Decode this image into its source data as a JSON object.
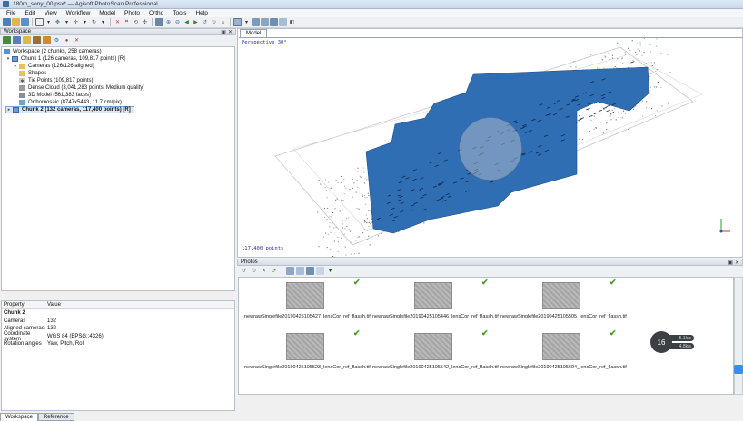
{
  "window": {
    "title": "180m_sony_00.psx* — Agisoft PhotoScan Professional"
  },
  "menubar": [
    "File",
    "Edit",
    "View",
    "Workflow",
    "Model",
    "Photo",
    "Ortho",
    "Tools",
    "Help"
  ],
  "workspace_panel": {
    "title": "Workspace",
    "tree": {
      "root": "Workspace (2 chunks, 258 cameras)",
      "chunk1": "Chunk 1 (126 cameras, 109,817 points) [R]",
      "chunk1_children": [
        {
          "label": "Cameras (126/126 aligned)",
          "icon": "folder-icon"
        },
        {
          "label": "Shapes",
          "icon": "folder-icon"
        },
        {
          "label": "Tie Points (109,817 points)",
          "icon": "points-icon"
        },
        {
          "label": "Dense Cloud (3,041,283 points, Medium quality)",
          "icon": "dense-cloud-icon"
        },
        {
          "label": "3D Model (561,383 faces)",
          "icon": "mesh-icon"
        },
        {
          "label": "Orthomosaic (8747x5443, 11.7 cm/pix)",
          "icon": "orthomosaic-icon"
        }
      ],
      "chunk2": "Chunk 2 (132 cameras, 117,400 points) [R]"
    }
  },
  "properties": {
    "header": {
      "property": "Property",
      "value": "Value"
    },
    "title": "Chunk 2",
    "rows": [
      {
        "k": "Cameras",
        "v": "132"
      },
      {
        "k": "Aligned cameras",
        "v": "132"
      },
      {
        "k": "Coordinate system",
        "v": "WGS 84 (EPSG::4326)"
      },
      {
        "k": "Rotation angles",
        "v": "Yaw, Pitch, Roll"
      }
    ]
  },
  "bottom_tabs": [
    "Workspace",
    "Reference"
  ],
  "model": {
    "tab": "Model",
    "view_label": "Perspective 30°",
    "points_label": "117,400 points"
  },
  "photos": {
    "title": "Photos",
    "items": [
      "newrawSinglefile20190425105427_lensCor_ref_flassh.tif",
      "newrawSinglefile20190425105446_lensCor_ref_flassh.tif",
      "newrawSinglefile20190425105505_lensCor_ref_flassh.tif",
      "newrawSinglefile20190425105523_lensCor_ref_flassh.tif",
      "newrawSinglefile20190425105542_lensCor_ref_flassh.tif",
      "newrawSinglefile20190425105604_lensCor_ref_flassh.tif"
    ]
  },
  "overlay": {
    "count": "16",
    "up_rate": "5.1k/s",
    "down_rate": "4.8k/s"
  },
  "colors": {
    "accent": "#3a6ea5",
    "camera_blue": "#2f6eb3",
    "check_green": "#4c9a2a"
  }
}
